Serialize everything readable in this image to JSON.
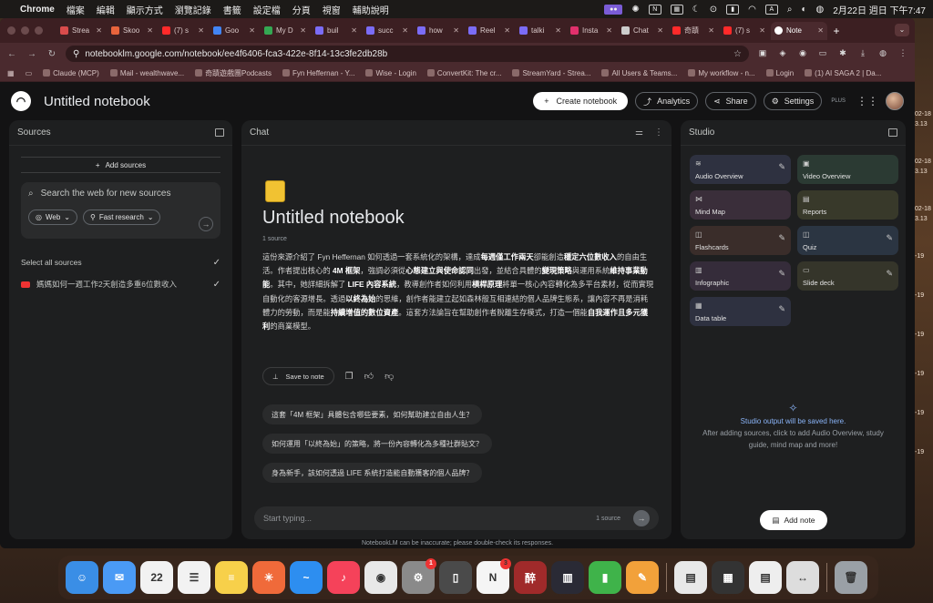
{
  "menubar": {
    "app_name": "Chrome",
    "menus": [
      "檔案",
      "編輯",
      "顯示方式",
      "瀏覽記錄",
      "書籤",
      "設定檔",
      "分頁",
      "視窗",
      "輔助說明"
    ],
    "date_time": "2月22日 週日 下午7:47"
  },
  "browser": {
    "tabs": [
      {
        "label": "Strea",
        "color": "#d94c4c"
      },
      {
        "label": "Skoo",
        "color": "#e8643c"
      },
      {
        "label": "(7) s",
        "color": "#ff2a2a"
      },
      {
        "label": "Goo",
        "color": "#4285f4"
      },
      {
        "label": "My D",
        "color": "#34a853"
      },
      {
        "label": "buil",
        "color": "#7b6cf6"
      },
      {
        "label": "succ",
        "color": "#7b6cf6"
      },
      {
        "label": "how",
        "color": "#7b6cf6"
      },
      {
        "label": "Reel",
        "color": "#7b6cf6"
      },
      {
        "label": "talki",
        "color": "#7b6cf6"
      },
      {
        "label": "Insta",
        "color": "#e1306c"
      },
      {
        "label": "Chat",
        "color": "#cccccc"
      },
      {
        "label": "奇蹟",
        "color": "#ff2a2a"
      },
      {
        "label": "(7) s",
        "color": "#ff2a2a"
      }
    ],
    "active_tab": "Note",
    "url": "notebooklm.google.com/notebook/ee4f6406-fca3-422e-8f14-13c3fe2db28b",
    "bookmarks": [
      "Claude (MCP)",
      "Mail - wealthwave...",
      "奇蹟遊戲團Podcasts",
      "Fyn Heffernan - Y...",
      "Wise - Login",
      "ConvertKit: The cr...",
      "StreamYard - Strea...",
      "All Users & Teams...",
      "My workflow - n...",
      "Login",
      "(1) AI SAGA 2 | Da..."
    ]
  },
  "app": {
    "title": "Untitled notebook",
    "create_label": "Create notebook",
    "analytics_label": "Analytics",
    "share_label": "Share",
    "settings_label": "Settings",
    "plus_label": "PLUS"
  },
  "sources": {
    "header": "Sources",
    "add_label": "Add sources",
    "search_placeholder": "Search the web for new sources",
    "web_chip": "Web",
    "research_chip": "Fast research",
    "select_all": "Select all sources",
    "items": [
      "媽媽如何一週工作2天創造多重6位數收入"
    ]
  },
  "chat": {
    "header": "Chat",
    "notebook_title": "Untitled notebook",
    "source_count": "1 source",
    "summary_parts": [
      {
        "t": "這份來源介紹了 Fyn Heffernan 如何透過一套系統化的架構，達成",
        "b": false
      },
      {
        "t": "每週僅工作兩天",
        "b": true
      },
      {
        "t": "卻能創造",
        "b": false
      },
      {
        "t": "穩定六位數收入",
        "b": true
      },
      {
        "t": "的自由生活。作者提出核心的 ",
        "b": false
      },
      {
        "t": "4M 框架",
        "b": true
      },
      {
        "t": "，強調必須從",
        "b": false
      },
      {
        "t": "心態建立與使命認同",
        "b": true
      },
      {
        "t": "出發，並結合具體的",
        "b": false
      },
      {
        "t": "變現策略",
        "b": true
      },
      {
        "t": "與運用系統",
        "b": false
      },
      {
        "t": "維持事業動能",
        "b": true
      },
      {
        "t": "。其中，她詳細拆解了 ",
        "b": false
      },
      {
        "t": "LIFE 內容系統",
        "b": true
      },
      {
        "t": "，教導創作者如何利用",
        "b": false
      },
      {
        "t": "槓桿原理",
        "b": true
      },
      {
        "t": "將單一核心內容轉化為多平台素材，從而實現自動化的客源增長。透過",
        "b": false
      },
      {
        "t": "以終為始",
        "b": true
      },
      {
        "t": "的思維，創作者能建立起如森林般互相連結的個人品牌生態系，讓內容不再是消耗體力的勞動，而是能",
        "b": false
      },
      {
        "t": "持續增值的數位資產",
        "b": true
      },
      {
        "t": "。這套方法論旨在幫助創作者脫離生存模式，打造一個能",
        "b": false
      },
      {
        "t": "自我運作且多元獲利",
        "b": true
      },
      {
        "t": "的商業模型。",
        "b": false
      }
    ],
    "save_note_label": "Save to note",
    "suggestions": [
      "這套「4M 框架」具體包含哪些要素，如何幫助建立自由人生？",
      "如何運用「以終為始」的策略，將一份內容轉化為多種社群貼文？",
      "身為新手，該如何透過 LIFE 系統打造能自動獲客的個人品牌？"
    ],
    "input_placeholder": "Start typing...",
    "input_source_count": "1 source"
  },
  "studio": {
    "header": "Studio",
    "tiles": [
      {
        "label": "Audio Overview",
        "bg": "#2e3140",
        "icon": "≋",
        "edit": true
      },
      {
        "label": "Video Overview",
        "bg": "#2b3a33",
        "icon": "▣",
        "edit": false
      },
      {
        "label": "Mind Map",
        "bg": "#3a2e3a",
        "icon": "⋈",
        "edit": false
      },
      {
        "label": "Reports",
        "bg": "#38392a",
        "icon": "▤",
        "edit": false
      },
      {
        "label": "Flashcards",
        "bg": "#3a2d2a",
        "icon": "◫",
        "edit": true
      },
      {
        "label": "Quiz",
        "bg": "#2b3542",
        "icon": "◫",
        "edit": true
      },
      {
        "label": "Infographic",
        "bg": "#352c3a",
        "icon": "▥",
        "edit": true
      },
      {
        "label": "Slide deck",
        "bg": "#35352a",
        "icon": "▭",
        "edit": true
      },
      {
        "label": "Data table",
        "bg": "#2e3140",
        "icon": "▦",
        "edit": true
      }
    ],
    "empty_title": "Studio output will be saved here.",
    "empty_text": "After adding sources, click to add Audio Overview, study guide, mind map and more!",
    "add_note_label": "Add note"
  },
  "disclaimer": "NotebookLM can be inaccurate; please double-check its responses.",
  "desktop_side": [
    "02-18",
    "3.13",
    "02-18",
    "3.13",
    "02-18",
    "3.13",
    "-19",
    "-19",
    "-19",
    "-19",
    "-19",
    "-19"
  ],
  "dock": [
    {
      "name": "finder",
      "bg": "#3a8ee6",
      "glyph": "☺"
    },
    {
      "name": "mail",
      "bg": "#4a9af5",
      "glyph": "✉"
    },
    {
      "name": "calendar",
      "bg": "#f2f2f2",
      "glyph": "22"
    },
    {
      "name": "reminders",
      "bg": "#f2f2f2",
      "glyph": "☰"
    },
    {
      "name": "notes",
      "bg": "#f7d04a",
      "glyph": "≡"
    },
    {
      "name": "perplexity",
      "bg": "#f06a3a",
      "glyph": "✳"
    },
    {
      "name": "freeform",
      "bg": "#2d8ef0",
      "glyph": "~"
    },
    {
      "name": "music",
      "bg": "#f5425a",
      "glyph": "♪"
    },
    {
      "name": "chrome",
      "bg": "#e8e8e8",
      "glyph": "◉"
    },
    {
      "name": "system-settings",
      "bg": "#8a8a8a",
      "glyph": "⚙",
      "badge": "1"
    },
    {
      "name": "iphone-mirroring",
      "bg": "#4a4a4a",
      "glyph": "▯"
    },
    {
      "name": "notion",
      "bg": "#f5f5f5",
      "glyph": "N",
      "badge": "3"
    },
    {
      "name": "app-red",
      "bg": "#a02a2a",
      "glyph": "醉"
    },
    {
      "name": "app-dark",
      "bg": "#2a2a35",
      "glyph": "▥"
    },
    {
      "name": "numbers",
      "bg": "#3fb34a",
      "glyph": "▮"
    },
    {
      "name": "pages",
      "bg": "#f2a13a",
      "glyph": "✎"
    },
    {
      "name": "doc-1",
      "bg": "#e8e8e8",
      "glyph": "▤"
    },
    {
      "name": "screenshot-1",
      "bg": "#333333",
      "glyph": "▦"
    },
    {
      "name": "doc-2",
      "bg": "#eeeeee",
      "glyph": "▤"
    },
    {
      "name": "screenshot-2",
      "bg": "#dddddd",
      "glyph": "↔"
    },
    {
      "name": "trash",
      "bg": "#9aa0a6",
      "glyph": "🗑"
    }
  ]
}
